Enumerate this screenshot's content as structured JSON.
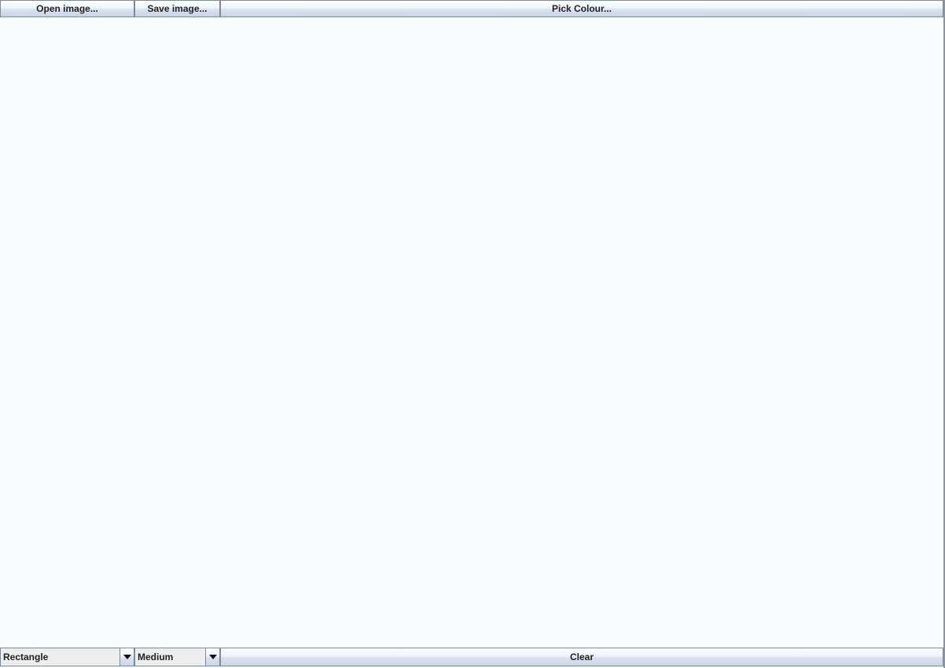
{
  "toolbar_top": {
    "open_label": "Open image...",
    "save_label": "Save image...",
    "pick_colour_label": "Pick Colour..."
  },
  "toolbar_bottom": {
    "shape_select": {
      "selected": "Rectangle"
    },
    "size_select": {
      "selected": "Medium"
    },
    "clear_label": "Clear"
  },
  "icons": {
    "dropdown": "chevron-down-icon"
  },
  "colors": {
    "canvas_background": "#f9fafc",
    "button_border": "#7a8a99"
  }
}
